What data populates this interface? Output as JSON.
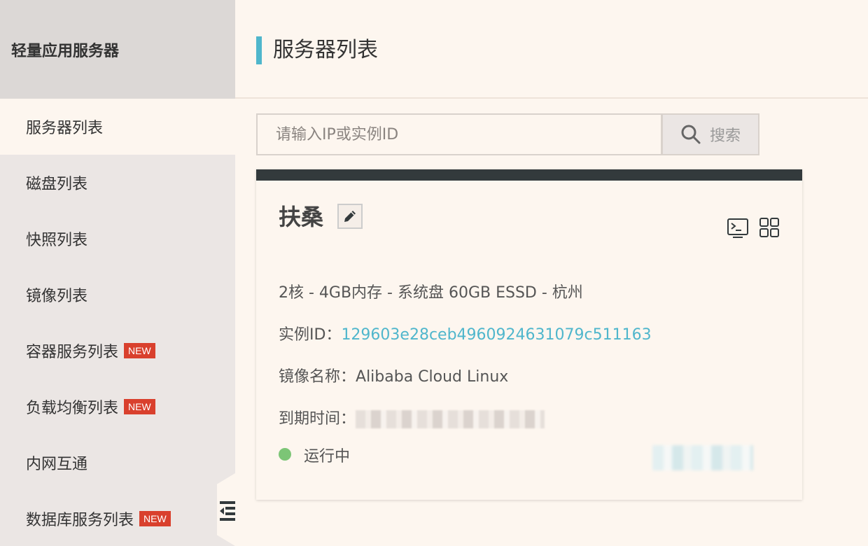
{
  "sidebar": {
    "title": "轻量应用服务器",
    "items": [
      {
        "label": "服务器列表",
        "badge": ""
      },
      {
        "label": "磁盘列表",
        "badge": ""
      },
      {
        "label": "快照列表",
        "badge": ""
      },
      {
        "label": "镜像列表",
        "badge": ""
      },
      {
        "label": "容器服务列表",
        "badge": "NEW"
      },
      {
        "label": "负载均衡列表",
        "badge": "NEW"
      },
      {
        "label": "内网互通",
        "badge": ""
      },
      {
        "label": "数据库服务列表",
        "badge": "NEW"
      }
    ]
  },
  "header": {
    "title": "服务器列表",
    "accent_color": "#4fb6cc"
  },
  "search": {
    "placeholder": "请输入IP或实例ID",
    "value": "",
    "button_label": "搜索"
  },
  "server": {
    "name": "扶桑",
    "spec": "2核 - 4GB内存 - 系统盘 60GB ESSD - 杭州",
    "instance_id_label": "实例ID：",
    "instance_id": "129603e28ceb4960924631079c511163",
    "image_label": "镜像名称：",
    "image_name": "Alibaba Cloud Linux",
    "expire_label": "到期时间：",
    "status": "运行中",
    "status_color": "#7cc576"
  },
  "icons": {
    "edit": "pencil-icon",
    "terminal": "terminal-icon",
    "apps": "grid-icon",
    "search": "search-icon",
    "collapse": "collapse-menu-icon"
  }
}
